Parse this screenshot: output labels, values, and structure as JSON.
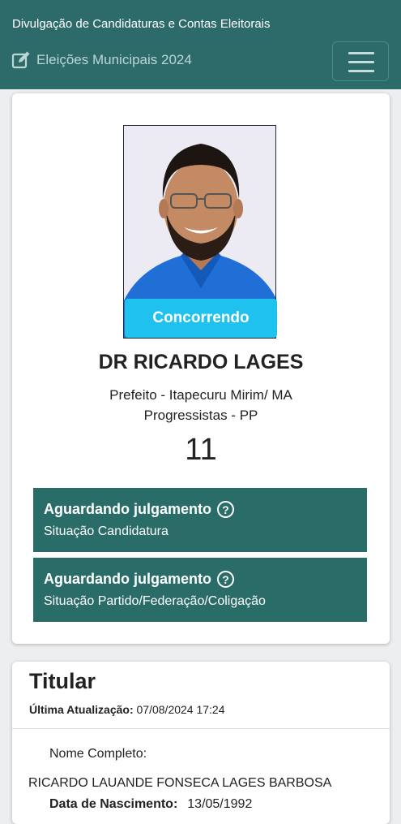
{
  "header": {
    "site_title": "Divulgação de Candidaturas e Contas Eleitorais",
    "election_label": "Eleições Municipais 2024",
    "menu_icon": "hamburger-menu-icon",
    "edit_icon": "edit-icon"
  },
  "candidate": {
    "status_pill": "Concorrendo",
    "name": "DR RICARDO LAGES",
    "office_line": "Prefeito - Itapecuru Mirim/ MA",
    "party_line": "Progressistas - PP",
    "number": "11"
  },
  "status_boxes": [
    {
      "title": "Aguardando julgamento",
      "subtitle": "Situação Candidatura"
    },
    {
      "title": "Aguardando julgamento",
      "subtitle": "Situação Partido/Federação/Coligação"
    }
  ],
  "titular": {
    "heading": "Titular",
    "update_label": "Última Atualização:",
    "update_value": "07/08/2024 17:24",
    "full_name_label": "Nome Completo:",
    "full_name_value": "RICARDO LAUANDE FONSECA LAGES BARBOSA",
    "birth_label": "Data de Nascimento:",
    "birth_value": "13/05/1992"
  },
  "colors": {
    "header_bg": "#2d6b6b",
    "status_box_bg": "#2a6c68",
    "status_pill_bg": "#1fc2ee"
  }
}
